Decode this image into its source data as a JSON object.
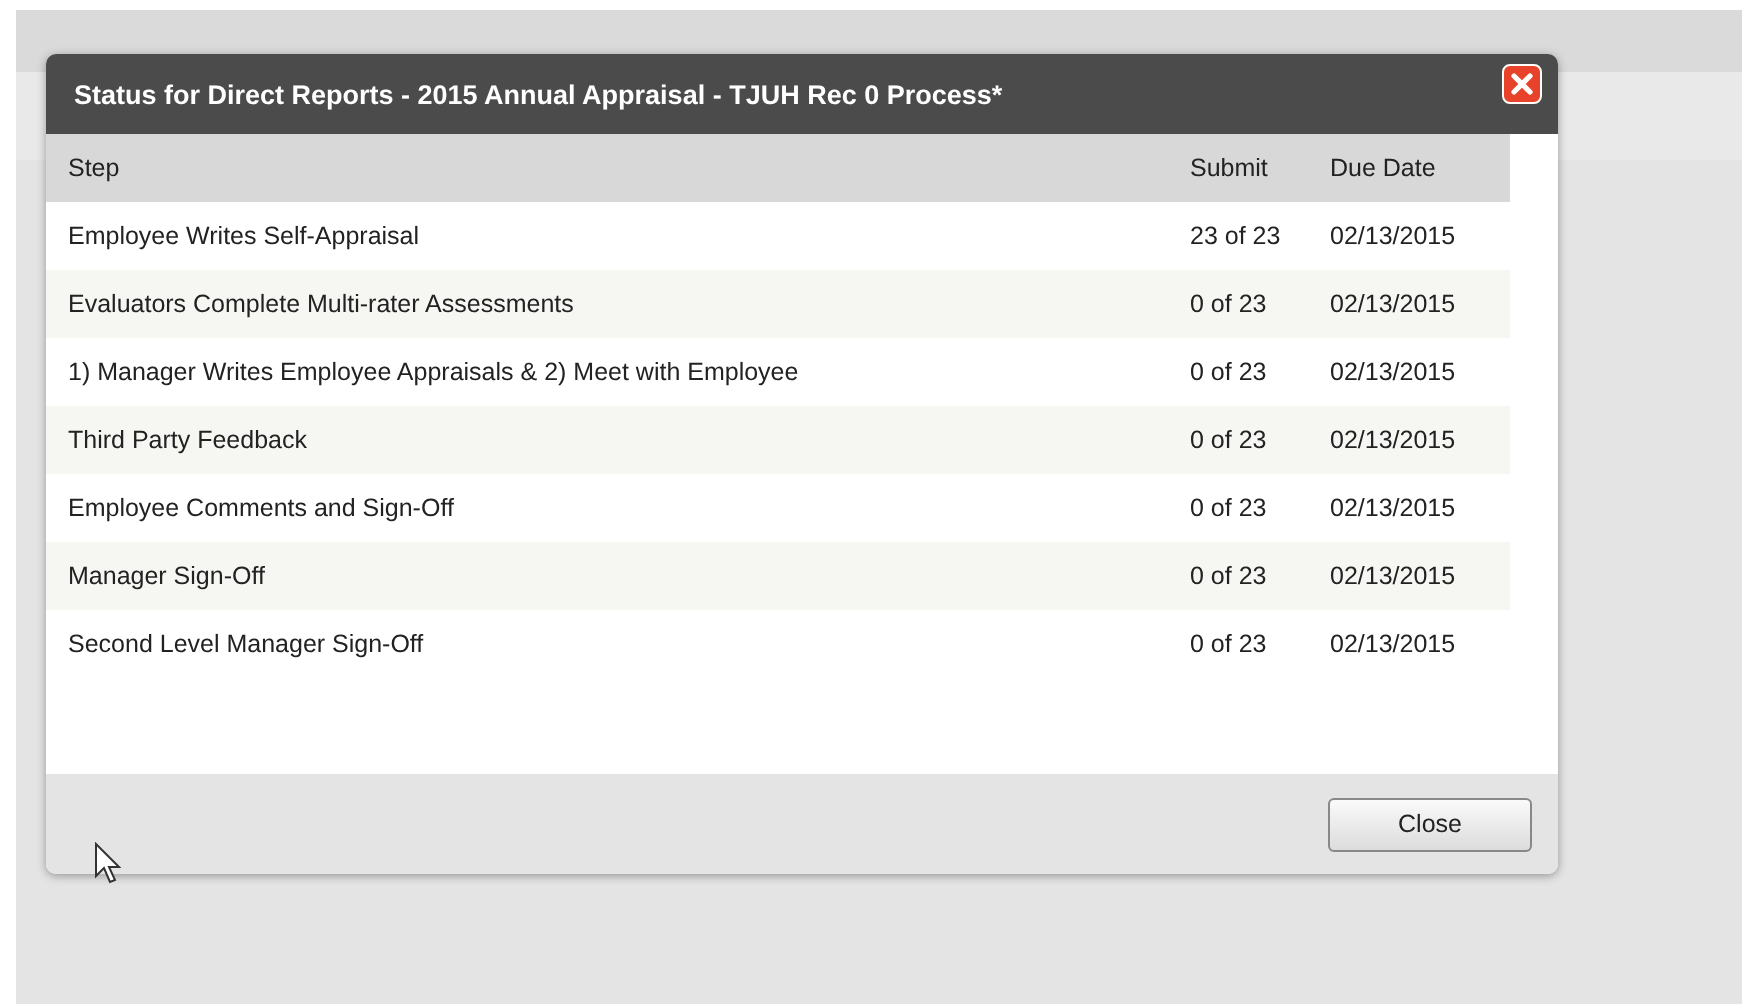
{
  "dialog": {
    "title": "Status for Direct Reports - 2015 Annual Appraisal - TJUH Rec 0 Process*"
  },
  "table": {
    "columns": [
      "Step",
      "Submit",
      "Due Date"
    ],
    "rows": [
      {
        "step": "Employee Writes Self-Appraisal",
        "submit": "23 of 23",
        "due_date": "02/13/2015"
      },
      {
        "step": "Evaluators Complete Multi-rater Assessments",
        "submit": "0 of 23",
        "due_date": "02/13/2015"
      },
      {
        "step": "1) Manager Writes Employee Appraisals & 2) Meet with Employee",
        "submit": "0 of 23",
        "due_date": "02/13/2015"
      },
      {
        "step": "Third Party Feedback",
        "submit": "0 of 23",
        "due_date": "02/13/2015"
      },
      {
        "step": "Employee Comments and Sign-Off",
        "submit": "0 of 23",
        "due_date": "02/13/2015"
      },
      {
        "step": "Manager Sign-Off",
        "submit": "0 of 23",
        "due_date": "02/13/2015"
      },
      {
        "step": "Second Level Manager Sign-Off",
        "submit": "0 of 23",
        "due_date": "02/13/2015"
      }
    ]
  },
  "buttons": [
    "Close"
  ]
}
